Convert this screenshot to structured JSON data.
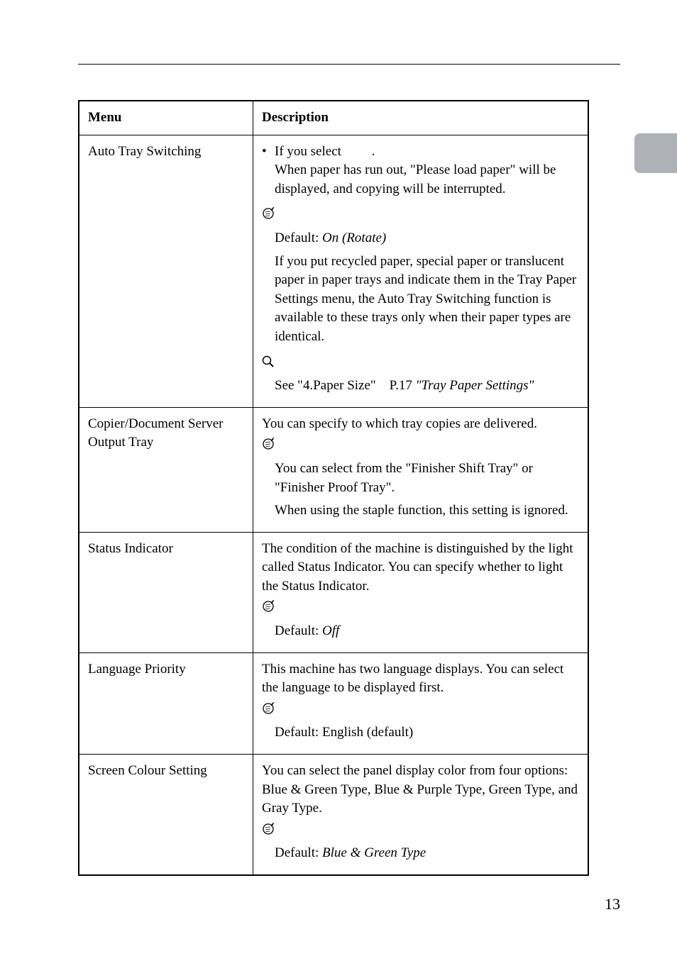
{
  "header": {
    "col1": "Menu",
    "col2": "Description"
  },
  "rows": {
    "autoTray": {
      "menu": "Auto Tray Switching",
      "bulletLead": "If you select",
      "bulletPeriod": ".",
      "bulletBody": "When paper has run out, \"Please load paper\" will be displayed, and copying will be interrupted.",
      "defaultLead": "Default: ",
      "defaultVal": "On (Rotate)",
      "para2": "If you put recycled paper, special paper or translucent paper in paper trays and indicate them in the Tray Paper Settings menu, the Auto Tray Switching function is available to these trays only when their paper types are identical.",
      "ref1": "See \"4.Paper Size\"",
      "ref2": "P.17 ",
      "ref3": "\"Tray Paper Settings\""
    },
    "copier": {
      "menu": "Copier/Document Server Output Tray",
      "intro": "You can specify to which tray copies are delivered.",
      "note1": "You can select from the \"Finisher Shift Tray\" or \"Finisher Proof Tray\".",
      "note2": "When using the staple function, this setting is ignored."
    },
    "status": {
      "menu": "Status Indicator",
      "body": "The condition of the machine is distinguished by the light called Status Indicator.  You can specify whether to light the Status Indicator.",
      "defaultLead": "Default: ",
      "defaultVal": "Off"
    },
    "lang": {
      "menu": "Language Priority",
      "body": "This machine has two language displays. You can select the language to be displayed first.",
      "default": "Default: English (default)"
    },
    "screen": {
      "menu": "Screen Colour Setting",
      "body": "You can select the panel display color from four options: Blue & Green Type, Blue & Purple Type, Green Type, and Gray Type.",
      "defaultLead": "Default: ",
      "defaultVal": "Blue & Green Type"
    }
  },
  "pageNumber": "13"
}
